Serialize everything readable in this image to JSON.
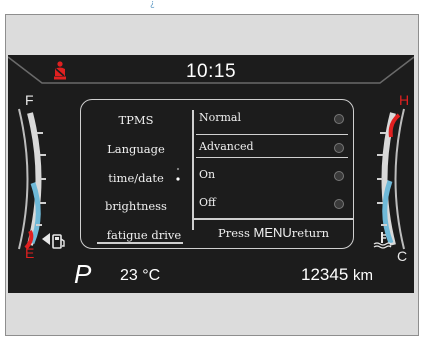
{
  "header_mark": "¿",
  "cluster": {
    "time": "10:15",
    "fuel_gauge": {
      "full_label": "F",
      "empty_label": "E"
    },
    "temp_gauge": {
      "hot_label": "H",
      "cold_label": "C"
    },
    "gear": "P",
    "outside_temperature": "23 °C",
    "odometer_value": "12345",
    "odometer_unit": "km"
  },
  "menu": {
    "items": [
      {
        "label": "TPMS"
      },
      {
        "label": "Language"
      },
      {
        "label": "time/date"
      },
      {
        "label": "brightness"
      },
      {
        "label": "fatigue drive"
      }
    ],
    "options": [
      {
        "label": "Normal",
        "selected": false
      },
      {
        "label": "Advanced",
        "selected": true
      },
      {
        "label": "On",
        "selected": false
      },
      {
        "label": "Off",
        "selected": false
      }
    ],
    "hint": {
      "press": "Press",
      "menu_word": "MENU",
      "action": "return"
    }
  },
  "colors": {
    "warning_red": "#e02020",
    "gauge_blue": "#6fb9d8",
    "panel_bg": "#1c1c1c"
  },
  "icons": [
    "seatbelt-warning-icon",
    "fuel-pump-icon",
    "coolant-temperature-icon"
  ]
}
